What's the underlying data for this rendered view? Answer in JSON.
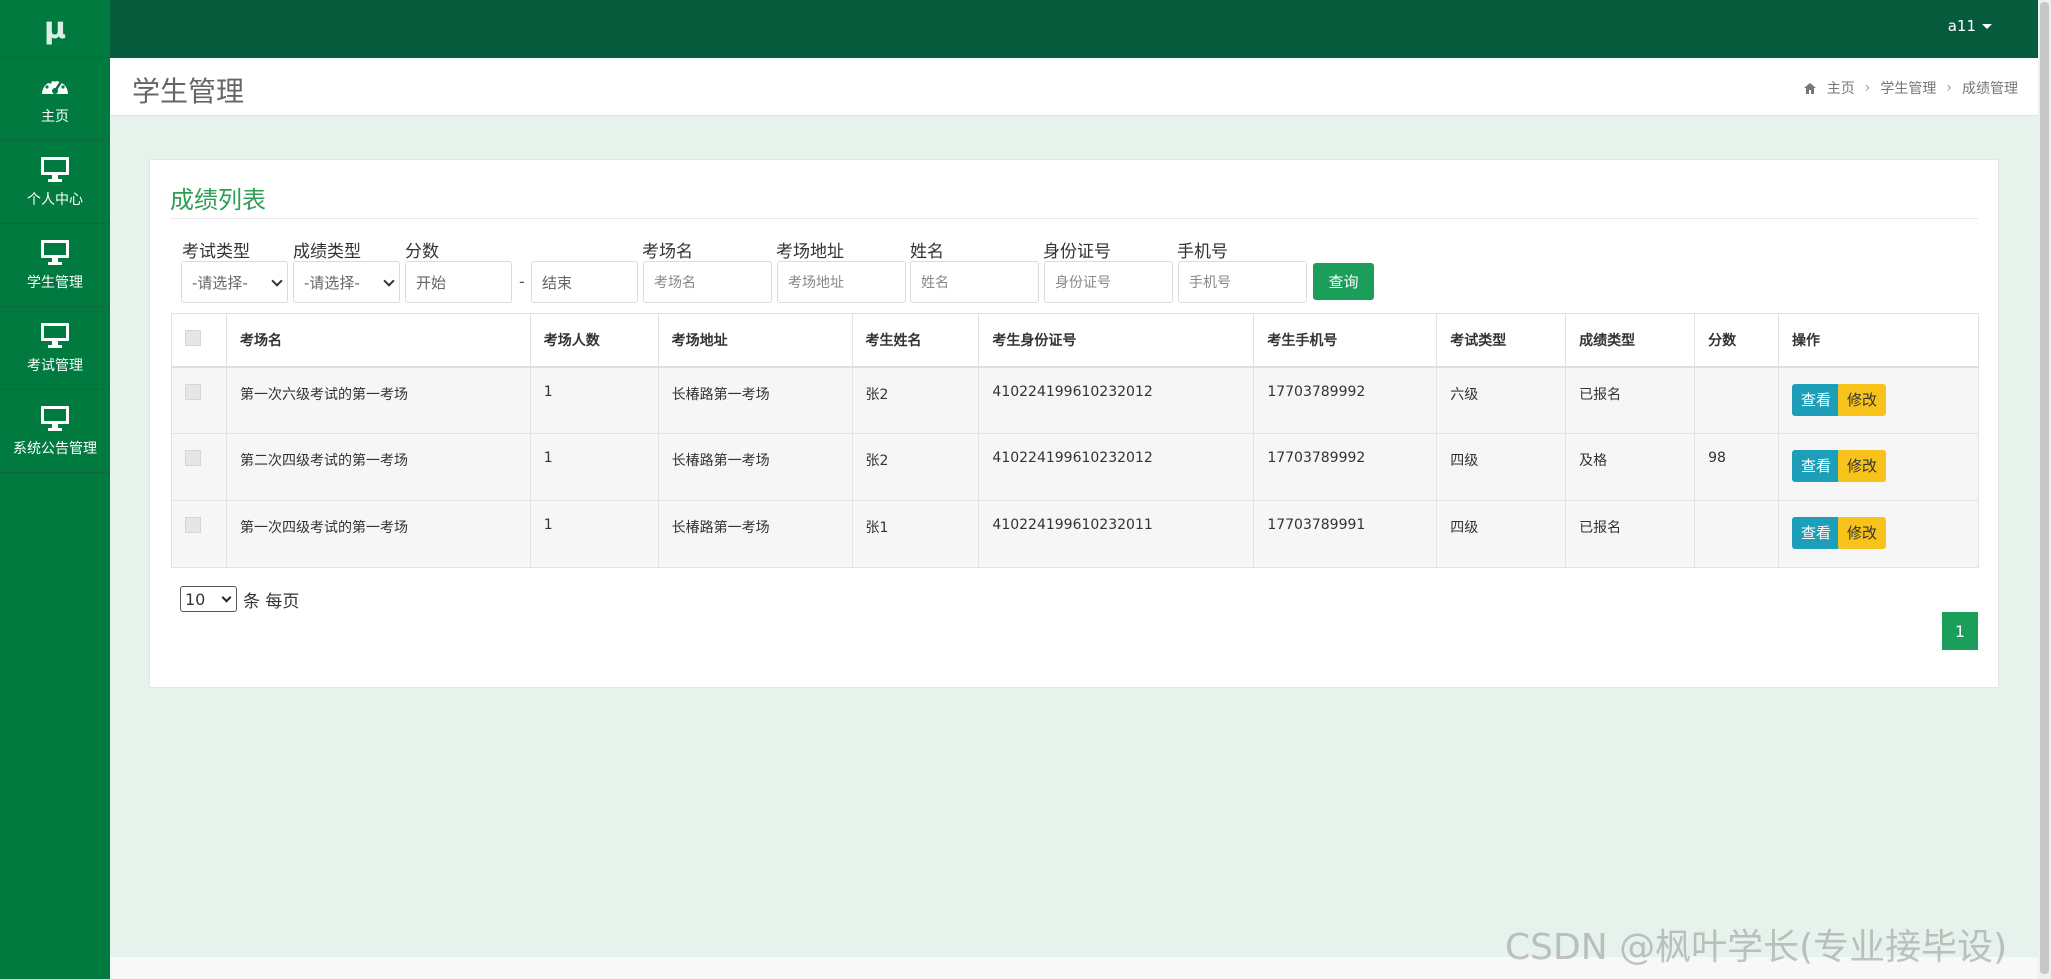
{
  "app": {
    "logo": "μ",
    "user": "a11"
  },
  "sidebar": {
    "items": [
      {
        "label": "主页",
        "icon": "dashboard-icon"
      },
      {
        "label": "个人中心",
        "icon": "monitor-icon"
      },
      {
        "label": "学生管理",
        "icon": "monitor-icon"
      },
      {
        "label": "考试管理",
        "icon": "monitor-icon"
      },
      {
        "label": "系统公告管理",
        "icon": "monitor-icon"
      }
    ]
  },
  "header": {
    "title": "学生管理",
    "breadcrumb": [
      "主页",
      "学生管理",
      "成绩管理"
    ]
  },
  "card": {
    "title": "成绩列表"
  },
  "filters": {
    "exam_type": {
      "label": "考试类型",
      "value": "-请选择-"
    },
    "score_type": {
      "label": "成绩类型",
      "value": "-请选择-"
    },
    "score": {
      "label": "分数",
      "start_placeholder": "开始",
      "end_placeholder": "结束",
      "separator": "-"
    },
    "room_name": {
      "label": "考场名",
      "placeholder": "考场名"
    },
    "room_addr": {
      "label": "考场地址",
      "placeholder": "考场地址"
    },
    "name": {
      "label": "姓名",
      "placeholder": "姓名"
    },
    "id_card": {
      "label": "身份证号",
      "placeholder": "身份证号"
    },
    "phone": {
      "label": "手机号",
      "placeholder": "手机号"
    },
    "query_label": "查询"
  },
  "table": {
    "columns": [
      "考场名",
      "考场人数",
      "考场地址",
      "考生姓名",
      "考生身份证号",
      "考生手机号",
      "考试类型",
      "成绩类型",
      "分数",
      "操作"
    ],
    "rows": [
      {
        "room": "第一次六级考试的第一考场",
        "count": "1",
        "addr": "长椿路第一考场",
        "name": "张2",
        "id": "410224199610232012",
        "phone": "17703789992",
        "exam": "六级",
        "status": "已报名",
        "score": ""
      },
      {
        "room": "第二次四级考试的第一考场",
        "count": "1",
        "addr": "长椿路第一考场",
        "name": "张2",
        "id": "410224199610232012",
        "phone": "17703789992",
        "exam": "四级",
        "status": "及格",
        "score": "98"
      },
      {
        "room": "第一次四级考试的第一考场",
        "count": "1",
        "addr": "长椿路第一考场",
        "name": "张1",
        "id": "410224199610232011",
        "phone": "17703789991",
        "exam": "四级",
        "status": "已报名",
        "score": ""
      }
    ],
    "view_label": "查看",
    "edit_label": "修改"
  },
  "pagination": {
    "page_size": "10",
    "page_size_suffix": "条 每页",
    "current_page": "1"
  },
  "watermark": "CSDN @枫叶学长(专业接毕设)",
  "colors": {
    "sidebar": "#007a3f",
    "topbar": "#055b3b",
    "accent": "#1b9e5a",
    "view": "#1e9fb9",
    "edit": "#f7c31a"
  }
}
